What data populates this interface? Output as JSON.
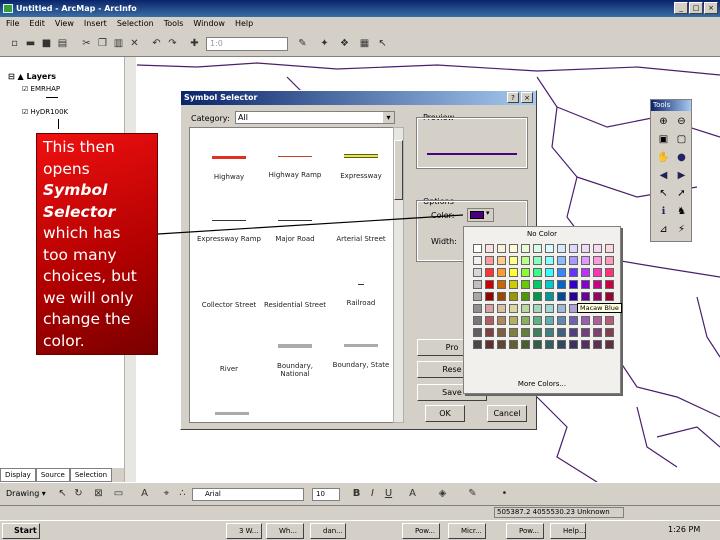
{
  "window": {
    "title": "Untitled - ArcMap - ArcInfo",
    "minimize": "_",
    "maximize": "□",
    "close": "×"
  },
  "menu": [
    "File",
    "Edit",
    "View",
    "Insert",
    "Selection",
    "Tools",
    "Window",
    "Help"
  ],
  "toolbar": {
    "scale": "1:0"
  },
  "toc": {
    "root": "Layers",
    "layers": [
      {
        "name": "EMRHAP",
        "checked": true
      },
      {
        "name": "HyDR100K",
        "checked": true
      }
    ],
    "tabs": [
      "Display",
      "Source",
      "Selection"
    ]
  },
  "callout": {
    "line1": "This then",
    "line2": "opens",
    "line3": "Symbol",
    "line4": "Selector",
    "line5": "which has",
    "line6": "too many",
    "line7": "choices, but",
    "line8": "we will only",
    "line9": "change the",
    "line10": "color."
  },
  "symbol_selector": {
    "title": "Symbol Selector",
    "help": "?",
    "close": "×",
    "category_label": "Category:",
    "category_value": "All",
    "preview_label": "Preview",
    "options_label": "Options",
    "color_label": "Color:",
    "width_label": "Width:",
    "properties_button": "Pro",
    "reset_button": "Rese",
    "save_button": "Save",
    "ok_button": "OK",
    "cancel_button": "Cancel",
    "symbols": [
      "Highway",
      "Highway Ramp",
      "Expressway",
      "Expressway Ramp",
      "Major Road",
      "Arterial Street",
      "Collector Street",
      "Residential Street",
      "Railroad",
      "River",
      "Boundary, National",
      "Boundary, State"
    ],
    "preview_color": "#4b0082"
  },
  "palette": {
    "no_color": "No Color",
    "more_colors": "More Colors...",
    "tooltip": "Macaw Blue"
  },
  "tools_panel": {
    "title": "Tools"
  },
  "drawing": {
    "label": "Drawing",
    "font": "Arial",
    "size": "10"
  },
  "status": {
    "coordinates": "505387.2 4055530.23 Unknown"
  },
  "taskbar": {
    "start": "Start",
    "tasks": [
      "3 W...",
      "Wh...",
      "dan...",
      "Pow...",
      "Micr...",
      "Pow...",
      "Help..."
    ],
    "clock": "1:26 PM"
  }
}
